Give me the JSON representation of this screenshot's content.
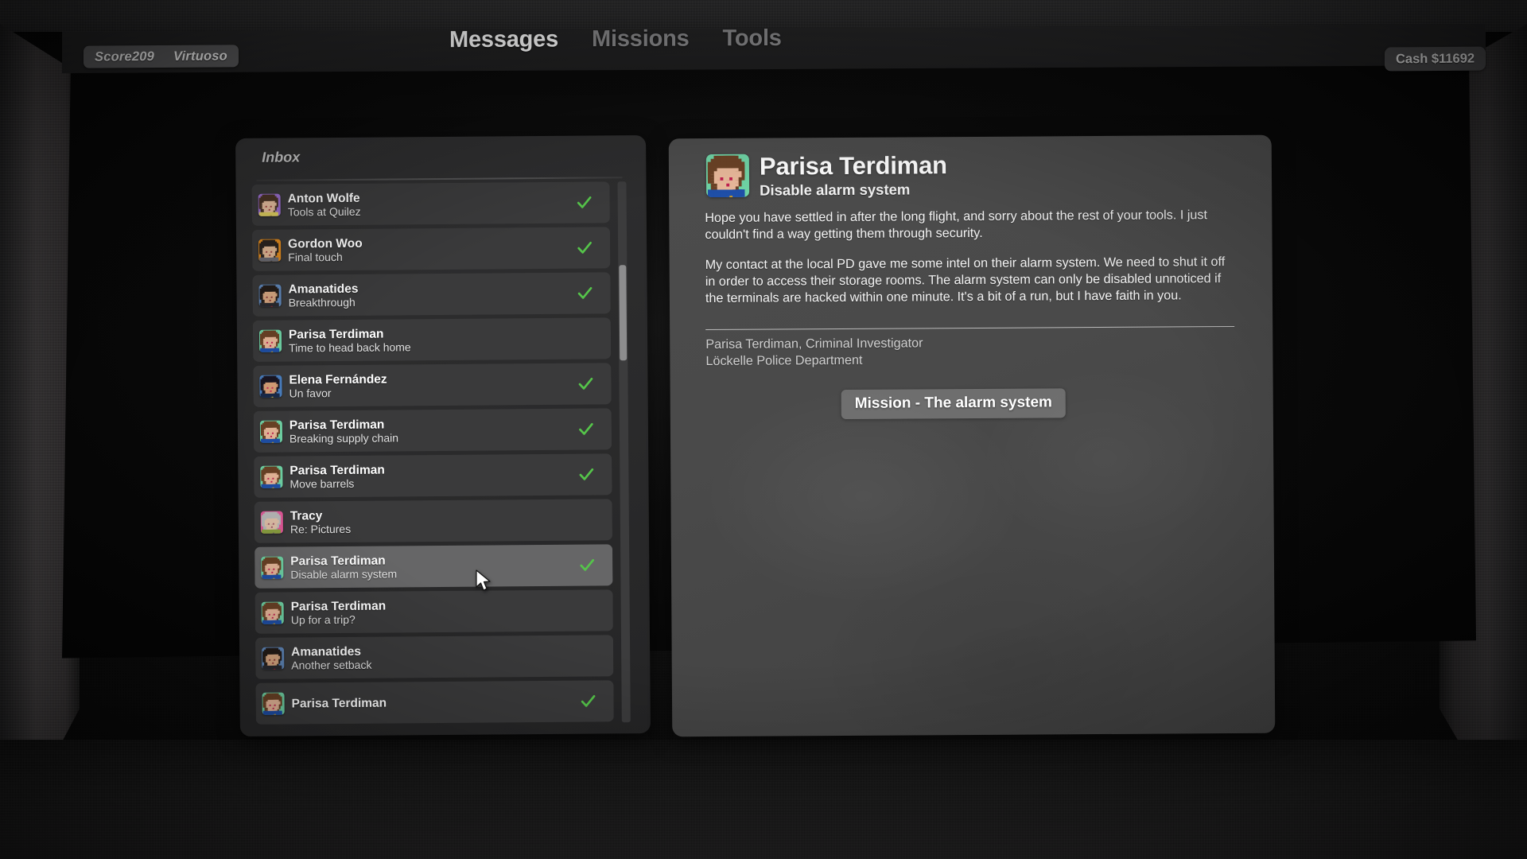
{
  "hud": {
    "score_label": "Score209",
    "rank_label": "Virtuoso",
    "cash_label": "Cash $11692"
  },
  "nav": {
    "items": [
      {
        "label": "Messages",
        "active": true
      },
      {
        "label": "Missions",
        "active": false
      },
      {
        "label": "Tools",
        "active": false
      }
    ]
  },
  "inbox": {
    "title": "Inbox",
    "messages": [
      {
        "sender": "Anton Wolfe",
        "subject": "Tools at Quilez",
        "read": true,
        "selected": false,
        "avatar": "anton"
      },
      {
        "sender": "Gordon Woo",
        "subject": "Final touch",
        "read": true,
        "selected": false,
        "avatar": "gordon"
      },
      {
        "sender": "Amanatides",
        "subject": "Breakthrough",
        "read": true,
        "selected": false,
        "avatar": "amanatides"
      },
      {
        "sender": "Parisa Terdiman",
        "subject": "Time to head back home",
        "read": false,
        "selected": false,
        "avatar": "parisa"
      },
      {
        "sender": "Elena Fernández",
        "subject": "Un favor",
        "read": true,
        "selected": false,
        "avatar": "elena"
      },
      {
        "sender": "Parisa Terdiman",
        "subject": "Breaking supply chain",
        "read": true,
        "selected": false,
        "avatar": "parisa"
      },
      {
        "sender": "Parisa Terdiman",
        "subject": "Move barrels",
        "read": true,
        "selected": false,
        "avatar": "parisa"
      },
      {
        "sender": "Tracy",
        "subject": "Re: Pictures",
        "read": false,
        "selected": false,
        "avatar": "tracy"
      },
      {
        "sender": "Parisa Terdiman",
        "subject": "Disable alarm system",
        "read": true,
        "selected": true,
        "avatar": "parisa"
      },
      {
        "sender": "Parisa Terdiman",
        "subject": "Up for a trip?",
        "read": false,
        "selected": false,
        "avatar": "parisa"
      },
      {
        "sender": "Amanatides",
        "subject": "Another setback",
        "read": false,
        "selected": false,
        "avatar": "amanatides"
      },
      {
        "sender": "Parisa Terdiman",
        "subject": "",
        "read": true,
        "selected": false,
        "avatar": "parisa"
      }
    ]
  },
  "detail": {
    "sender": "Parisa Terdiman",
    "subject": "Disable alarm system",
    "paragraphs": [
      "Hope you have settled in after the long flight, and sorry about the rest of your tools. I just couldn't find a way getting them through security.",
      "My contact at the local PD gave me some intel on their alarm system. We need to shut it off in order to access their storage rooms. The alarm system can only be disabled unnoticed if the terminals are hacked within one minute. It's a bit of a run, but I have faith in you."
    ],
    "signature": [
      "Parisa Terdiman, Criminal Investigator",
      "Löckelle Police Department"
    ],
    "mission_button": "Mission - The alarm system"
  },
  "colors": {
    "check_green": "#55c44a",
    "selected_row": "#666667",
    "row": "#3a3a3b",
    "panel_dark": "#2a2a2b",
    "panel_light": "#4a4a4a",
    "nav_active": "#ffffff",
    "nav_inactive": "#8b8b8d"
  }
}
